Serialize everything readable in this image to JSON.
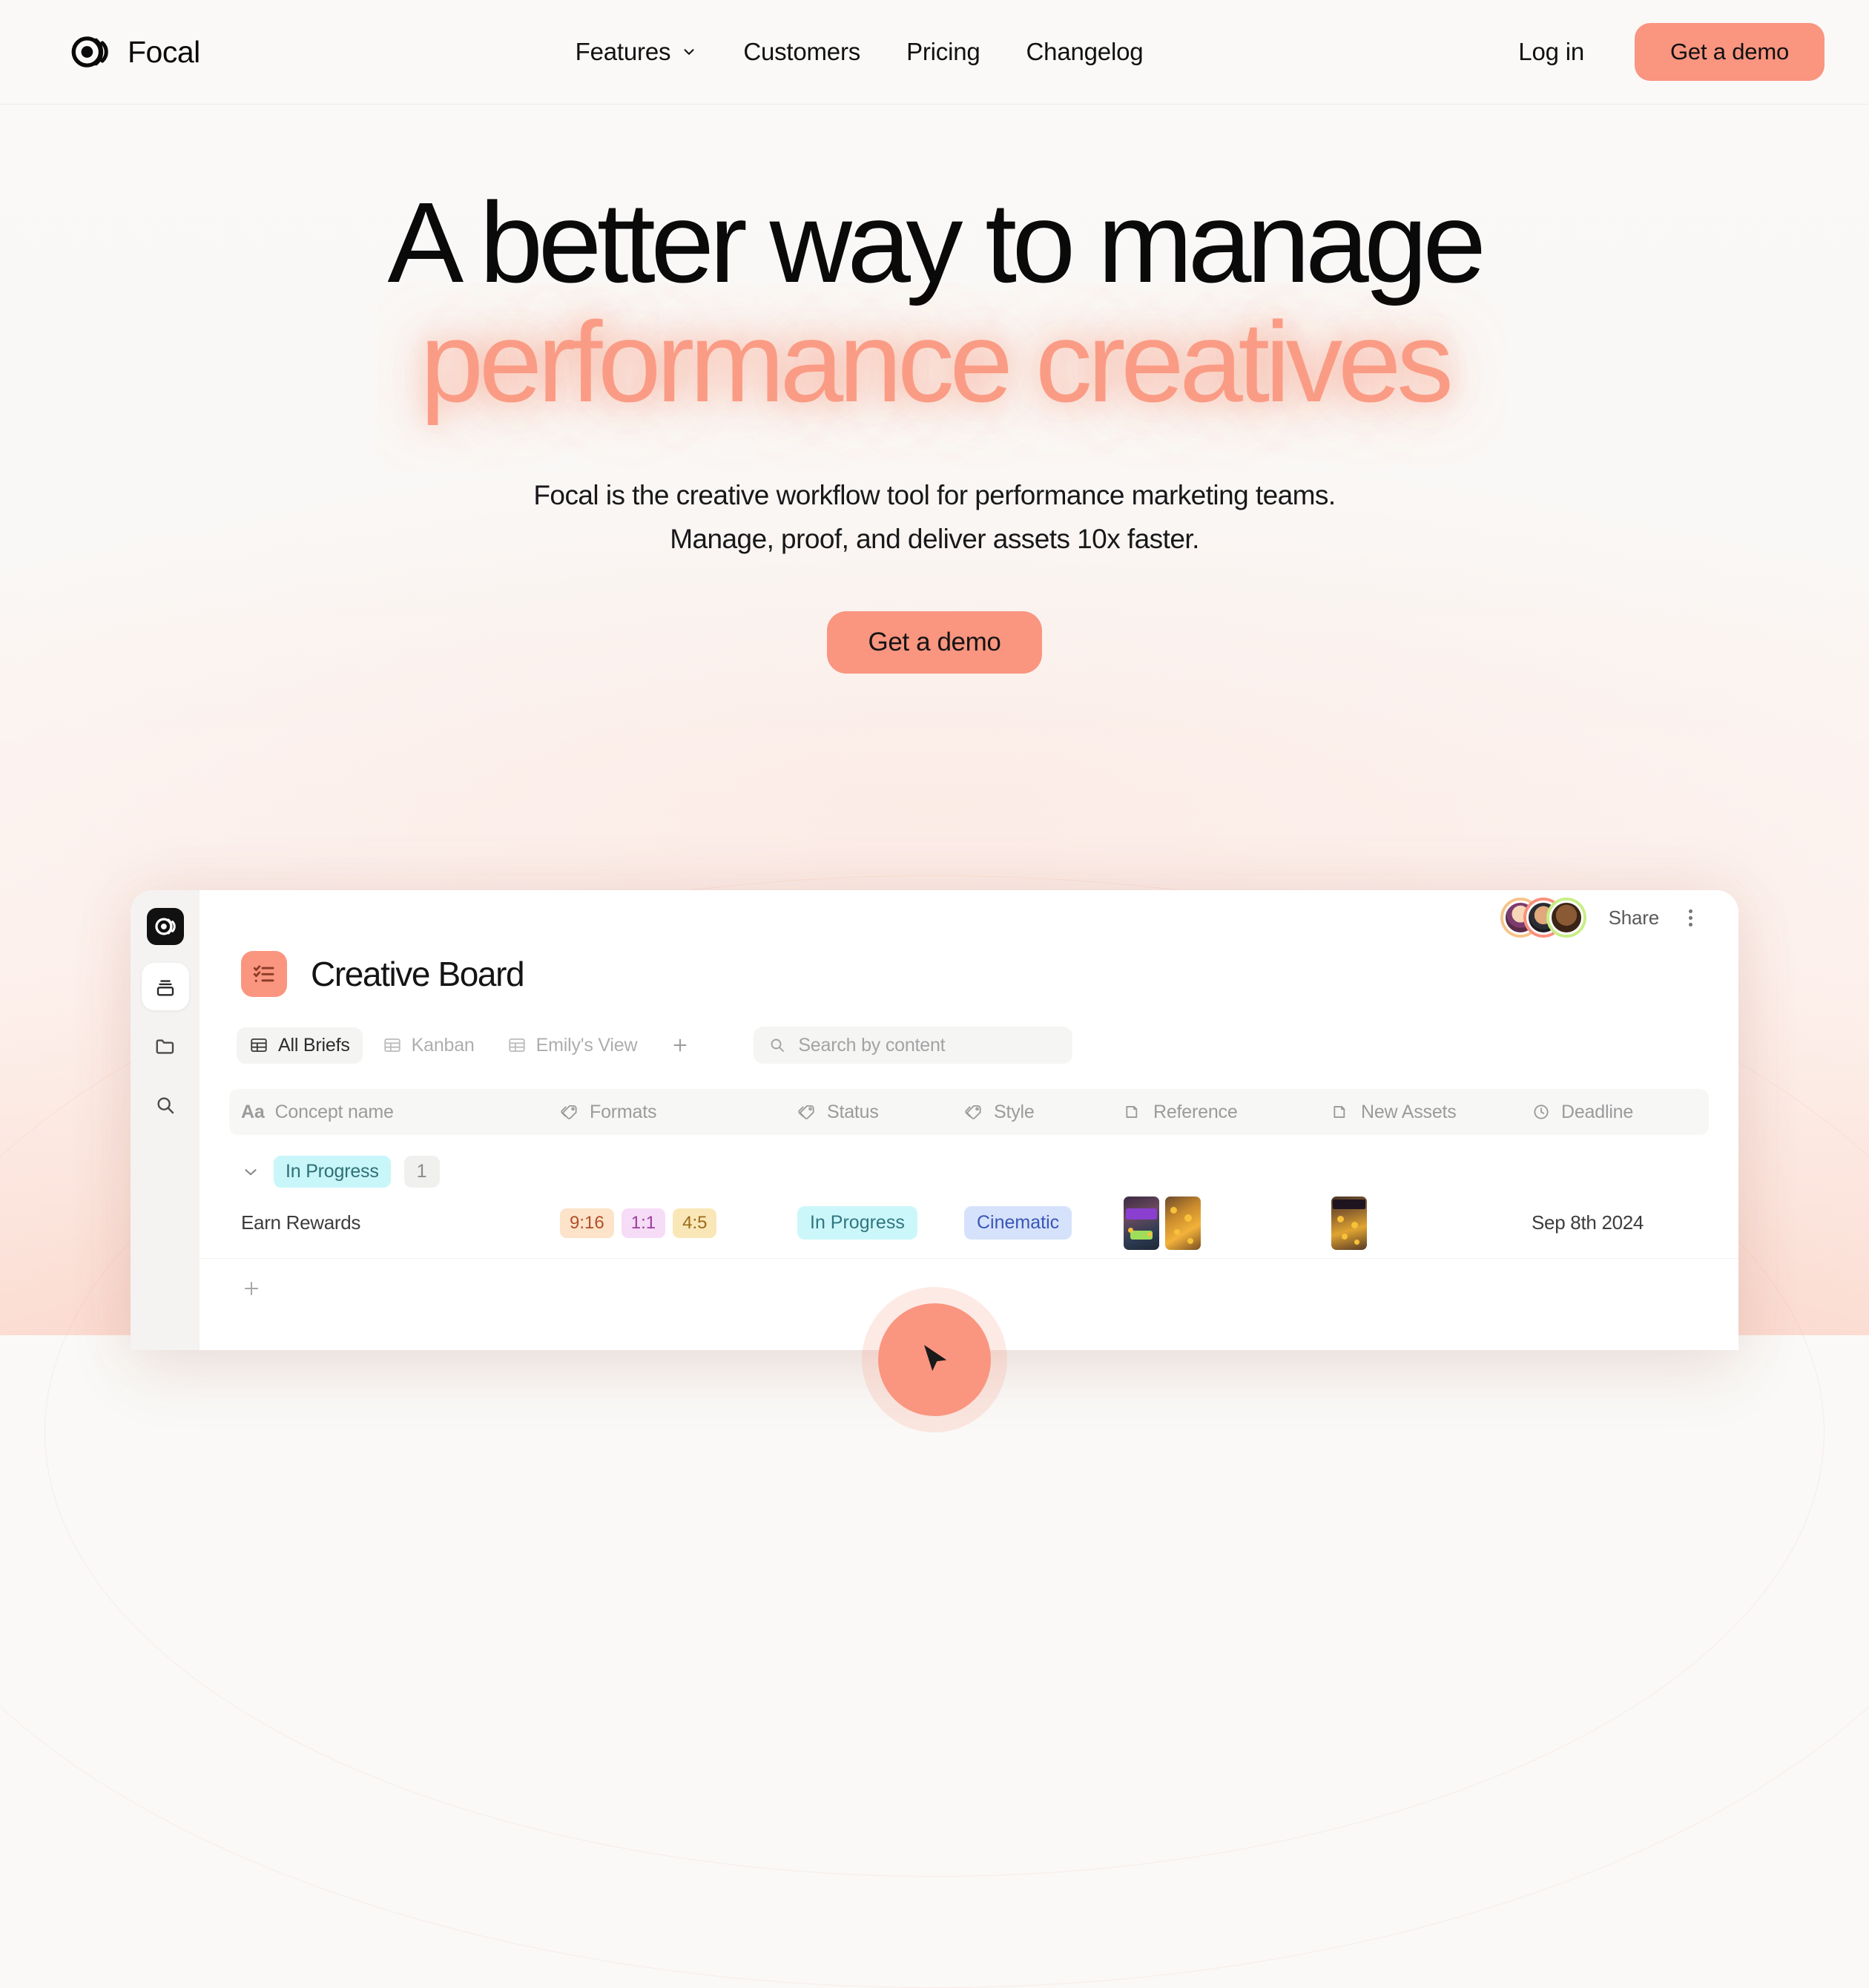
{
  "brand": {
    "name": "Focal",
    "logo_icon": "focal-sonar-logo"
  },
  "nav": {
    "links": [
      {
        "label": "Features",
        "has_caret": true
      },
      {
        "label": "Customers",
        "has_caret": false
      },
      {
        "label": "Pricing",
        "has_caret": false
      },
      {
        "label": "Changelog",
        "has_caret": false
      }
    ],
    "login_label": "Log in",
    "cta_label": "Get a demo"
  },
  "hero": {
    "headline_line1": "A better way to manage",
    "headline_line2": "performance creatives",
    "subhead_line1": "Focal is the creative workflow tool for performance marketing teams.",
    "subhead_line2": "Manage, proof, and deliver assets 10x faster.",
    "cta_label": "Get a demo",
    "accent_color": "#fa9c85"
  },
  "app": {
    "sidebar": [
      {
        "name": "archive",
        "icon": "archive-stack-icon",
        "active": true
      },
      {
        "name": "folder",
        "icon": "folder-icon",
        "active": false
      },
      {
        "name": "search",
        "icon": "search-icon",
        "active": false
      }
    ],
    "topbar": {
      "share_label": "Share",
      "avatars": [
        {
          "ring": "#f6c48a"
        },
        {
          "ring": "#fa8f7c"
        },
        {
          "ring": "#c8ee86"
        }
      ]
    },
    "board": {
      "title": "Creative Board",
      "icon": "checklist-icon",
      "icon_bg": "#fa9580"
    },
    "tabs": [
      {
        "label": "All Briefs",
        "icon": "table-icon",
        "active": true
      },
      {
        "label": "Kanban",
        "icon": "table-icon",
        "active": false
      },
      {
        "label": "Emily's View",
        "icon": "table-icon",
        "active": false
      }
    ],
    "tab_add_icon": "plus-icon",
    "search": {
      "placeholder": "Search by content",
      "icon": "search-icon"
    },
    "columns": [
      {
        "label": "Concept name",
        "icon": "text-aa-icon"
      },
      {
        "label": "Formats",
        "icon": "tag-icon"
      },
      {
        "label": "Status",
        "icon": "tag-icon"
      },
      {
        "label": "Style",
        "icon": "tag-icon"
      },
      {
        "label": "Reference",
        "icon": "folder-icon"
      },
      {
        "label": "New Assets",
        "icon": "folder-icon"
      },
      {
        "label": "Deadline",
        "icon": "clock-icon"
      }
    ],
    "group": {
      "label": "In Progress",
      "count": "1",
      "chevron_icon": "chevron-down-icon"
    },
    "rows": [
      {
        "concept_name": "Earn Rewards",
        "formats": [
          "9:16",
          "1:1",
          "4:5"
        ],
        "status": "In Progress",
        "style": "Cinematic",
        "reference_count": 2,
        "new_assets_count": 1,
        "deadline": "Sep 8th 2024"
      }
    ],
    "add_row_icon": "plus-icon",
    "fab_icon": "cursor-icon"
  }
}
